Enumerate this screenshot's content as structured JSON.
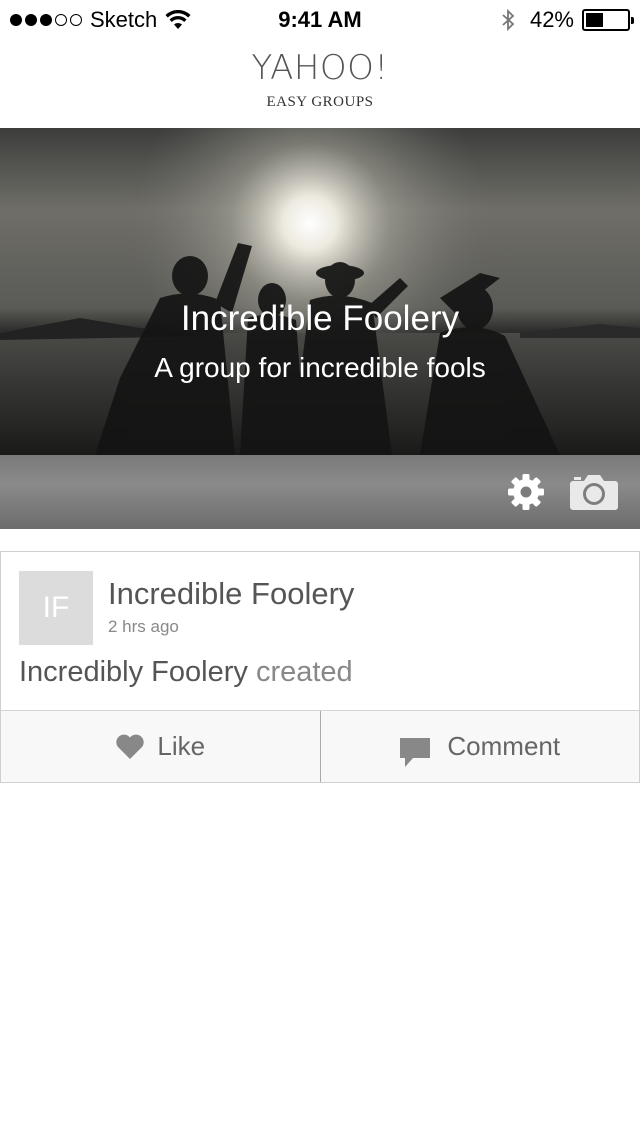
{
  "status_bar": {
    "carrier": "Sketch",
    "time": "9:41 AM",
    "battery_percent_text": "42%",
    "battery_level": 0.42,
    "signal_dots_filled": 3,
    "signal_dots_total": 5
  },
  "header": {
    "title": "YAHOO!",
    "subtitle": "EASY GROUPS"
  },
  "group": {
    "name": "Incredible Foolery",
    "description": "A group for incredible fools",
    "toolbar_icons": [
      "settings-gear-icon",
      "camera-icon"
    ]
  },
  "post": {
    "avatar_initials": "IF",
    "author": "Incredible Foolery",
    "time": "2 hrs ago",
    "body_subject": "Incredibly Foolery",
    "body_action": "created",
    "like_label": "Like",
    "comment_label": "Comment",
    "like_icon": "heart-icon",
    "comment_icon": "speech-bubble-icon"
  },
  "colors": {
    "text_dark": "#555555",
    "text_muted": "#888888",
    "avatar_bg": "#dcdcdc",
    "hero_bar": "#7a7a7a"
  }
}
